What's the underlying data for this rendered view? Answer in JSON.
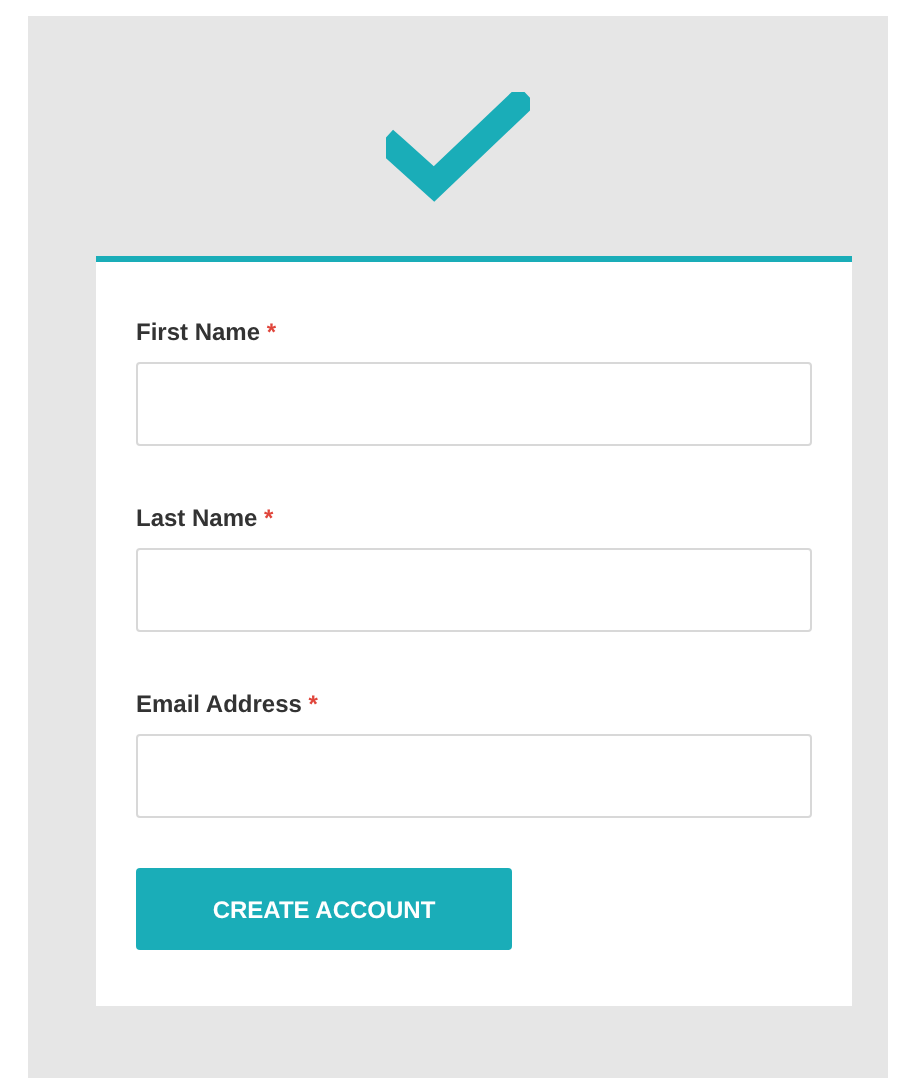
{
  "form": {
    "fields": [
      {
        "label": "First Name",
        "required_mark": "*"
      },
      {
        "label": "Last Name",
        "required_mark": "*"
      },
      {
        "label": "Email Address",
        "required_mark": "*"
      }
    ],
    "button": "CREATE ACCOUNT"
  }
}
